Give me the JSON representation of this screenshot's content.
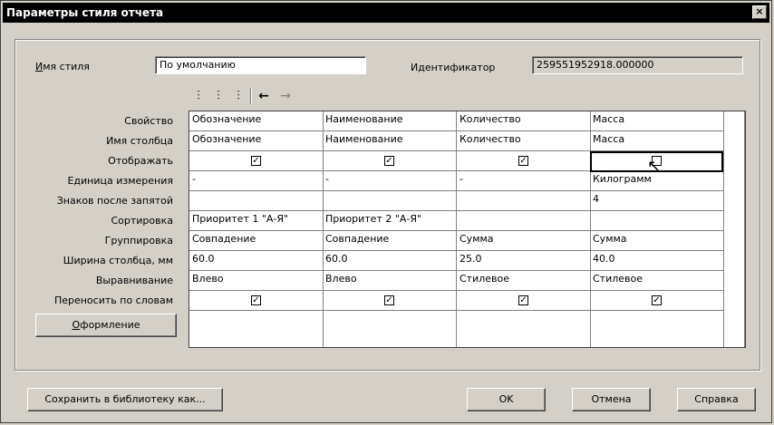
{
  "window": {
    "title": "Параметры стиля отчета",
    "close": "×"
  },
  "style_name": {
    "label": "Имя стиля",
    "value": "По умолчанию"
  },
  "identifier": {
    "label": "Идентификатор",
    "value": "259551952918.000000"
  },
  "toolbar": [
    "insert-column-icon",
    "insert-column-right-icon",
    "delete-column-icon",
    "move-left-icon",
    "move-right-icon"
  ],
  "row_labels": [
    "Свойство",
    "Имя столбца",
    "Отображать",
    "Единица измерения",
    "Знаков после запятой",
    "Сортировка",
    "Группировка",
    "Ширина столбца, мм",
    "Выравнивание",
    "Переносить по словам"
  ],
  "columns": [
    {
      "property": "Обозначение",
      "name": "Обозначение",
      "show": true,
      "unit": "-",
      "decimals": "",
      "sort": "Приоритет 1 \"А-Я\"",
      "group": "Совпадение",
      "width": "60.0",
      "align": "Влево",
      "wrap": true
    },
    {
      "property": "Наименование",
      "name": "Наименование",
      "show": true,
      "unit": "-",
      "decimals": "",
      "sort": "Приоритет 2 \"А-Я\"",
      "group": "Совпадение",
      "width": "60.0",
      "align": "Влево",
      "wrap": true
    },
    {
      "property": "Количество",
      "name": "Количество",
      "show": true,
      "unit": "-",
      "decimals": "",
      "sort": "",
      "group": "Сумма",
      "width": "25.0",
      "align": "Стилевое",
      "wrap": true
    },
    {
      "property": "Масса",
      "name": "Масса",
      "show": false,
      "unit": "Килограмм",
      "decimals": "4",
      "sort": "",
      "group": "Сумма",
      "width": "40.0",
      "align": "Стилевое",
      "wrap": true
    }
  ],
  "buttons": {
    "design": "Оформление",
    "save_library": "Сохранить в библиотеку как...",
    "ok": "OK",
    "cancel": "Отмена",
    "help": "Справка"
  }
}
